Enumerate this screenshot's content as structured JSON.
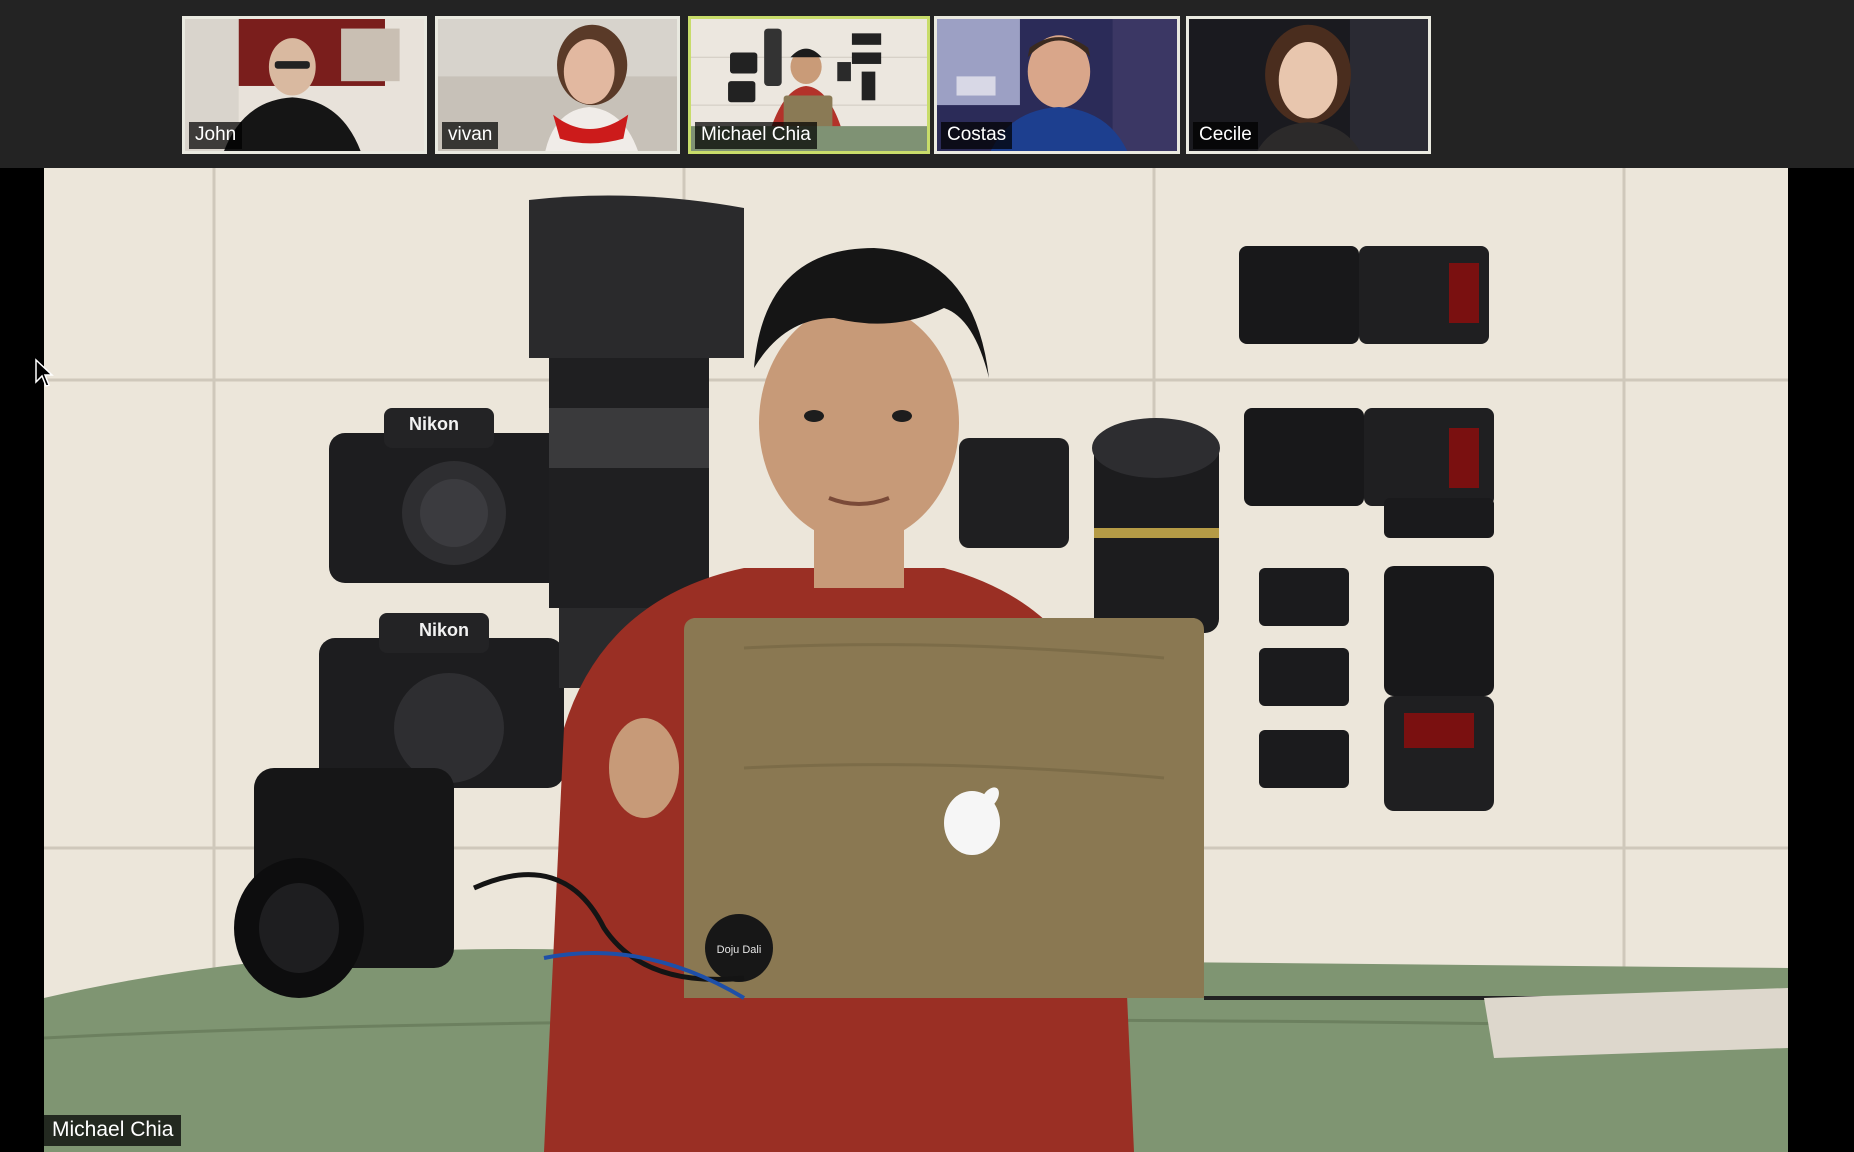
{
  "participants": [
    {
      "name": "John",
      "active": false
    },
    {
      "name": "vivan",
      "active": false
    },
    {
      "name": "Michael Chia",
      "active": true
    },
    {
      "name": "Costas",
      "active": false
    },
    {
      "name": "Cecile",
      "active": false
    }
  ],
  "main_video": {
    "speaker_name": "Michael Chia",
    "props": {
      "camera_brand": "Nikon",
      "laptop_sticker": "Doju Dali"
    }
  },
  "colors": {
    "active_border": "#c8dc6a",
    "tile_border": "#e9e9e0",
    "background": "#232323"
  },
  "icons": {
    "cursor": "mouse-pointer-icon"
  }
}
